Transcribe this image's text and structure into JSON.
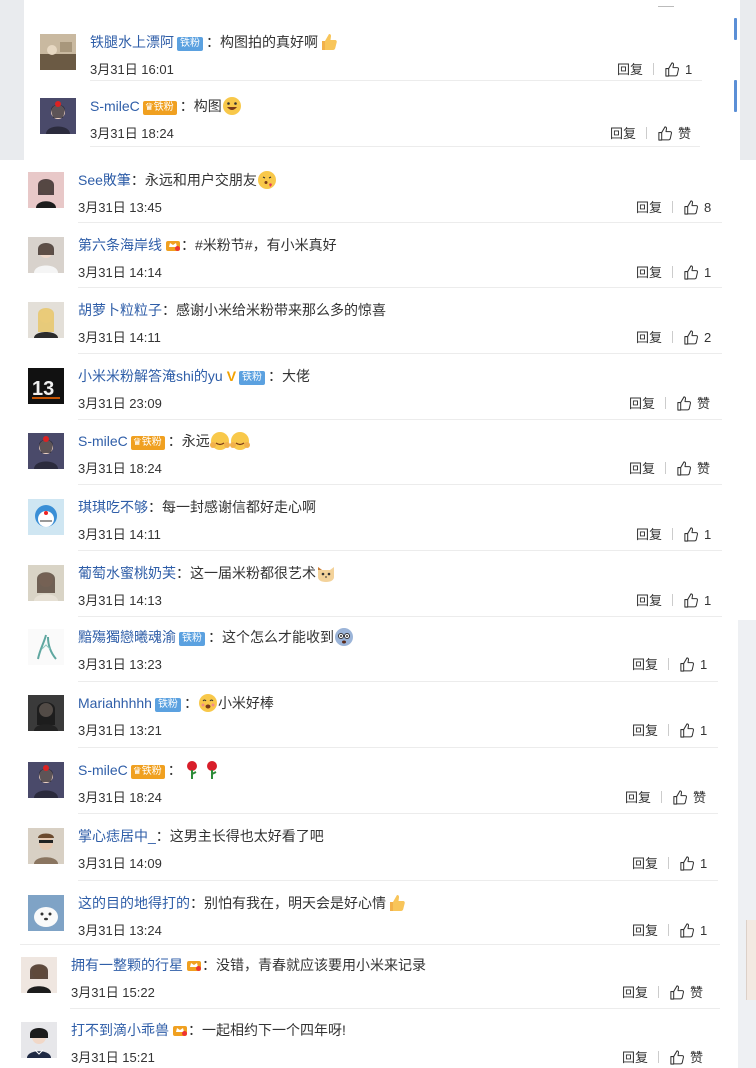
{
  "comments": [
    {
      "user": "铁腿水上漂阿",
      "badge": "铁粉",
      "text": "构图拍的真好啊",
      "emoji": "thumbs-up",
      "time": "3月31日 16:01",
      "reply": "回复",
      "like": "1"
    },
    {
      "user": "S-mileC",
      "badge": "铁粉",
      "crown": true,
      "text": "构图",
      "emoji": "laugh",
      "time": "3月31日 18:24",
      "reply": "回复",
      "like": "赞"
    },
    {
      "user": "See敗筆",
      "text": "永远和用户交朋友",
      "emoji": "kiss",
      "time": "3月31日 13:45",
      "reply": "回复",
      "like": "8"
    },
    {
      "user": "第六条海岸线",
      "crown_only": true,
      "text": "#米粉节#，有小米真好",
      "time": "3月31日 14:14",
      "reply": "回复",
      "like": "1"
    },
    {
      "user": "胡萝卜粒粒子",
      "text": "感谢小米给米粉带来那么多的惊喜",
      "time": "3月31日 14:11",
      "reply": "回复",
      "like": "2"
    },
    {
      "user": "小米米粉解答淹shi的yu",
      "vip": "V",
      "badge": "铁粉",
      "text": "大佬",
      "time": "3月31日 23:09",
      "reply": "回复",
      "like": "赞"
    },
    {
      "user": "S-mileC",
      "badge": "铁粉",
      "crown": true,
      "text": "永远",
      "emoji": "hug-hug",
      "time": "3月31日 18:24",
      "reply": "回复",
      "like": "赞"
    },
    {
      "user": "琪琪吃不够",
      "text": "每一封感谢信都好走心啊",
      "time": "3月31日 14:11",
      "reply": "回复",
      "like": "1"
    },
    {
      "user": "葡萄水蜜桃奶芙",
      "text": "这一届米粉都很艺术",
      "emoji": "cat",
      "time": "3月31日 14:13",
      "reply": "回复",
      "like": "1"
    },
    {
      "user": "黯殤獨戀曦魂渝",
      "badge": "铁粉",
      "text": "这个怎么才能收到",
      "emoji": "dizzy",
      "time": "3月31日 13:23",
      "reply": "回复",
      "like": "1"
    },
    {
      "user": "Mariahhhhh",
      "badge": "铁粉",
      "text": "小米好棒",
      "emoji_before": "smile",
      "time": "3月31日 13:21",
      "reply": "回复",
      "like": "1"
    },
    {
      "user": "S-mileC",
      "badge": "铁粉",
      "crown": true,
      "text": "",
      "emoji": "roses",
      "time": "3月31日 18:24",
      "reply": "回复",
      "like": "赞"
    },
    {
      "user": "掌心痣居中_",
      "text": "这男主长得也太好看了吧",
      "time": "3月31日 14:09",
      "reply": "回复",
      "like": "1"
    },
    {
      "user": "这的目的地得打的",
      "text": "别怕有我在，明天会是好心情",
      "emoji": "thumbs-up",
      "time": "3月31日 13:24",
      "reply": "回复",
      "like": "1"
    },
    {
      "user": "拥有一整颗的行星",
      "crown_only": true,
      "text": "没错，青春就应该要用小米来记录",
      "time": "3月31日 15:22",
      "reply": "回复",
      "like": "赞"
    },
    {
      "user": "打不到滴小乖兽",
      "crown_only": true,
      "text": "一起相约下一个四年呀!",
      "time": "3月31日 15:21",
      "reply": "回复",
      "like": "赞"
    }
  ],
  "colors": {
    "username": "#2f5ea8",
    "badge": "#5ba1e0",
    "crown": "#f0a020"
  }
}
